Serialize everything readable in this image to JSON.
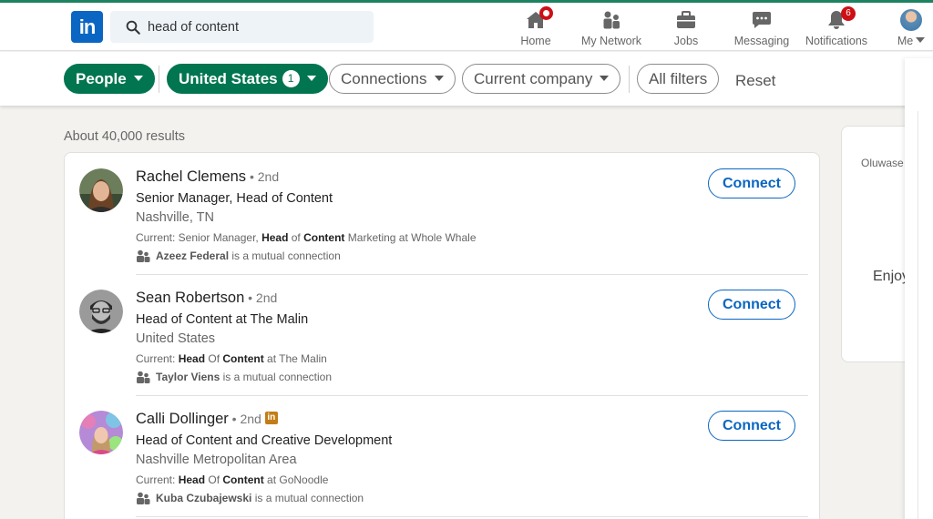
{
  "header": {
    "logo_text": "in",
    "search_value": "head of content",
    "nav": [
      {
        "label": "Home",
        "icon": "home-icon"
      },
      {
        "label": "My Network",
        "icon": "network-icon"
      },
      {
        "label": "Jobs",
        "icon": "briefcase-icon"
      },
      {
        "label": "Messaging",
        "icon": "chat-icon"
      },
      {
        "label": "Notifications",
        "icon": "bell-icon",
        "badge": "6"
      },
      {
        "label": "Me",
        "icon": "avatar"
      }
    ]
  },
  "filters": {
    "people": "People",
    "location": "United States",
    "location_count": "1",
    "connections": "Connections",
    "current_company": "Current company",
    "all_filters": "All filters",
    "reset": "Reset"
  },
  "results": {
    "count_text": "About 40,000 results",
    "connect_label": "Connect",
    "items": [
      {
        "name": "Rachel Clemens",
        "degree": " • 2nd",
        "headline": "Senior Manager, Head of Content",
        "location": "Nashville, TN",
        "current_prefix": "Current: Senior Manager, ",
        "current_b1": "Head",
        "current_mid": " of ",
        "current_b2": "Content",
        "current_suffix": " Marketing at Whole Whale",
        "mutual_name": "Azeez Federal",
        "mutual_suffix": " is a mutual connection"
      },
      {
        "name": "Sean Robertson",
        "degree": " • 2nd",
        "headline": "Head of Content at The Malin",
        "location": "United States",
        "current_prefix": "Current: ",
        "current_b1": "Head",
        "current_mid": " Of ",
        "current_b2": "Content",
        "current_suffix": " at The Malin",
        "mutual_name": "Taylor Viens",
        "mutual_suffix": " is a mutual connection"
      },
      {
        "name": "Calli Dollinger",
        "degree": " • 2nd",
        "badge": "in",
        "headline": "Head of Content and Creative Development",
        "location": "Nashville Metropolitan Area",
        "current_prefix": "Current: ",
        "current_b1": "Head",
        "current_mid": " Of ",
        "current_b2": "Content",
        "current_suffix": " at GoNoodle",
        "mutual_name": "Kuba Czubajewski",
        "mutual_suffix": " is a mutual connection"
      }
    ]
  },
  "side": {
    "line1": "Oluwase",
    "line2": "Enjoy"
  },
  "colors": {
    "accent_green": "#01754f",
    "link_blue": "#0a66c2",
    "badge_red": "#cc1016",
    "premium_gold": "#c37d16"
  }
}
